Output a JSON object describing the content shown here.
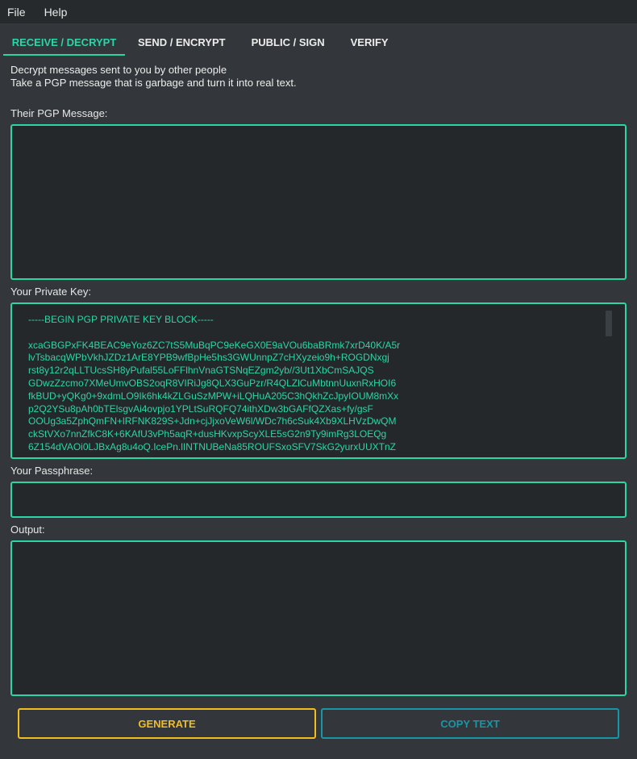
{
  "menu": {
    "items": [
      "File",
      "Help"
    ]
  },
  "tabs": [
    {
      "label": "RECEIVE / DECRYPT",
      "active": true
    },
    {
      "label": "SEND / ENCRYPT",
      "active": false
    },
    {
      "label": "PUBLIC / SIGN",
      "active": false
    },
    {
      "label": "VERIFY",
      "active": false
    }
  ],
  "description": {
    "line1": "Decrypt messages sent to you by other people",
    "line2": "Take a PGP message that is garbage and turn it into real text."
  },
  "fields": {
    "message_label": "Their PGP Message:",
    "message_value": "",
    "key_label": "Your Private Key:",
    "key_value": "-----BEGIN PGP PRIVATE KEY BLOCK-----\n\nxcaGBGPxFK4BEAC9eYoz6ZC7tS5MuBqPC9eKeGX0E9aVOu6baBRmk7xrD40K/A5r\nlvTsbacqWPbVkhJZDz1ArE8YPB9wfBpHe5hs3GWUnnpZ7cHXyzeio9h+ROGDNxgj\nrst8y12r2qLLTUcsSH8yPufal55LoFFlhnVnaGTSNqEZgm2yb//3Ut1XbCmSAJQS\nGDwzZzcmo7XMeUmvOBS2oqR8VIRiJg8QLX3GuPzr/R4QLZlCuMbtnnUuxnRxHOI6\nfkBUD+yQKg0+9xdmLO9Ik6hk4kZLGuSzMPW+iLQHuA205C3hQkhZcJpyIOUM8mXx\np2Q2YSu8pAh0bTElsgvAi4ovpjo1YPLtSuRQFQ74ithXDw3bGAFfQZXas+fy/gsF\nOOUg3a5ZphQmFN+lRFNK829S+Jdn+cjJjxoVeW6l/WDc7h6cSuk4Xb9XLHVzDwQM\nckStVXo7nnZfkC8K+6KAfU3vPh5aqR+dusHKvxpScyXLE5sG2n9Ty9imRg3LOEQg\n6Z154dVAOi0LJBxAg8u4oQ.IcePn.lINTNUBeNa85ROUFSxoSFV7SkG2yurxUUXTnZ",
    "passphrase_label": "Your Passphrase:",
    "passphrase_value": "",
    "output_label": "Output:",
    "output_value": ""
  },
  "buttons": {
    "generate": "GENERATE",
    "copy": "COPY TEXT"
  },
  "colors": {
    "accent": "#2bd6a6",
    "generate": "#f1be1e",
    "copy": "#1796a8",
    "background": "#33373b",
    "field_background": "#25282b"
  }
}
